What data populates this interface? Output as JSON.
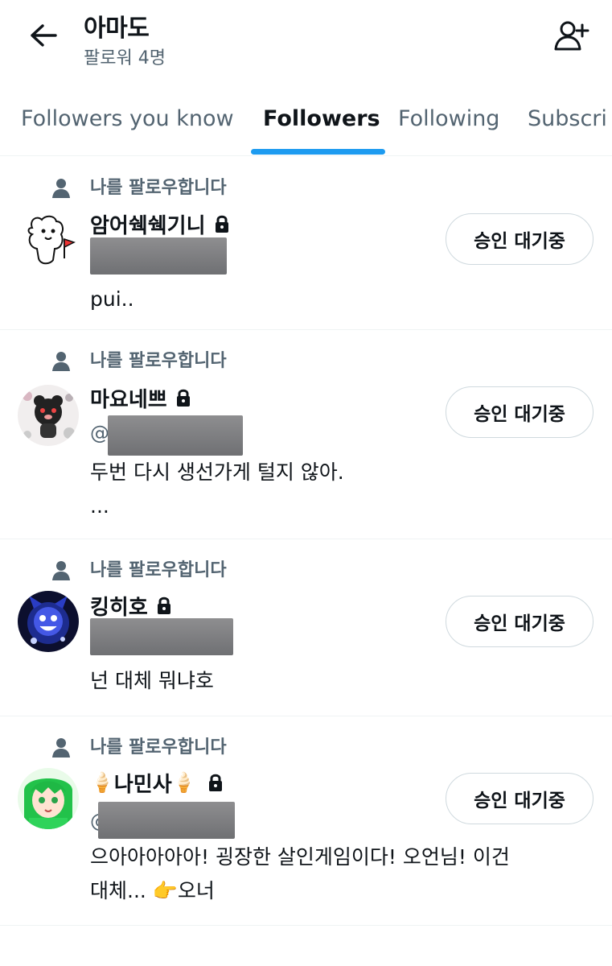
{
  "header": {
    "title": "아마도",
    "subtitle": "팔로워 4명",
    "back_icon": "arrow-left-icon",
    "add_user_icon": "person-plus-icon"
  },
  "tabs": [
    {
      "label": "Followers you know",
      "active": false
    },
    {
      "label": "Followers",
      "active": true
    },
    {
      "label": "Following",
      "active": false
    },
    {
      "label": "Subscri",
      "active": false
    }
  ],
  "colors": {
    "accent": "#1d9bf0",
    "text": "#0f1419",
    "secondary": "#536471",
    "border": "#eff3f4"
  },
  "followers": [
    {
      "context": "나를 팔로우합니다",
      "name": "암어쉑쉑기니",
      "handle_prefix": "",
      "bio": "pui..",
      "bio_line2": "",
      "button": "승인 대기중",
      "protected": true,
      "avatar": "white-bear-sketch"
    },
    {
      "context": "나를 팔로우합니다",
      "name": "마요네쁘",
      "handle_prefix": "@",
      "bio": "두번 다시 생선가게 털지 않아.",
      "bio_line2": "...",
      "button": "승인 대기중",
      "protected": true,
      "avatar": "black-bear-collage"
    },
    {
      "context": "나를 팔로우합니다",
      "name": "킹히호",
      "handle_prefix": "",
      "bio": "넌 대체 뭐냐호",
      "bio_line2": "",
      "button": "승인 대기중",
      "protected": true,
      "avatar": "blue-frost-character"
    },
    {
      "context": "나를 팔로우합니다",
      "name": "나민사",
      "name_prefix_emoji": "🍦",
      "name_suffix_emoji": "🍦",
      "handle_prefix": "@",
      "bio": "으아아아아아! 굉장한 살인게임이다! 오언님! 이건",
      "bio_line2": "대체... 👉오너",
      "button": "승인 대기중",
      "protected": true,
      "avatar": "green-hair-anime-girl"
    }
  ]
}
